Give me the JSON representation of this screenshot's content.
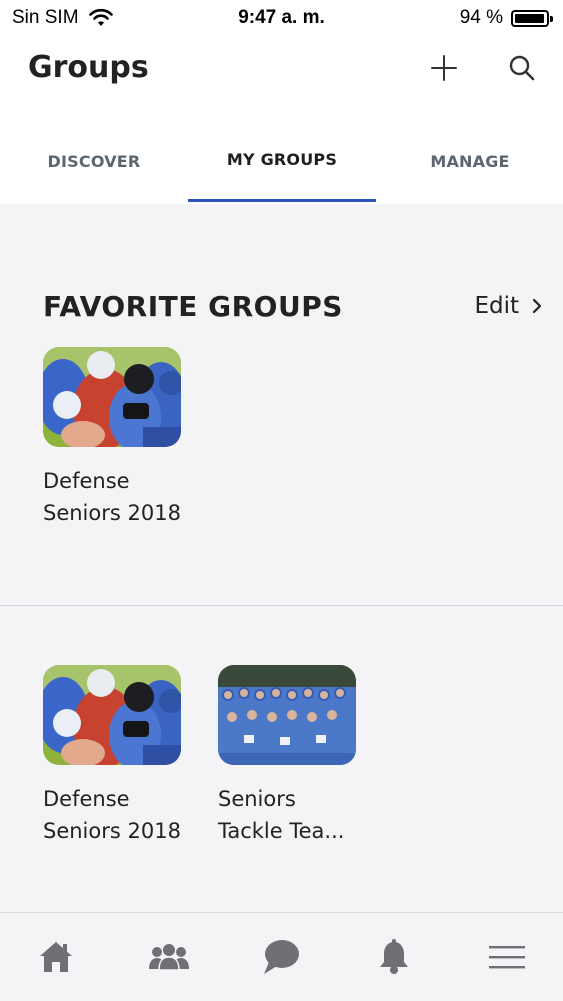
{
  "status_bar": {
    "carrier": "Sin SIM",
    "time": "9:47 a. m.",
    "battery": "94 %",
    "battery_level": 0.94
  },
  "header": {
    "title": "Groups",
    "add_icon": "plus-icon",
    "search_icon": "search-icon"
  },
  "tabs": [
    {
      "label": "DISCOVER",
      "active": false
    },
    {
      "label": "MY GROUPS",
      "active": true
    },
    {
      "label": "MANAGE",
      "active": false
    }
  ],
  "accent_color": "#2a52b8",
  "favorites": {
    "title": "FAVORITE GROUPS",
    "edit_label": "Edit",
    "items": [
      {
        "name_line1": "Defense",
        "name_line2": "Seniors 2018",
        "image": "football-tackle-photo"
      }
    ]
  },
  "groups": {
    "items": [
      {
        "name_line1": "Defense",
        "name_line2": "Seniors 2018",
        "image": "football-tackle-photo"
      },
      {
        "name_line1": "Seniors",
        "name_line2": "Tackle Tea...",
        "image": "team-photo"
      }
    ]
  },
  "tab_bar": [
    {
      "icon": "home-icon"
    },
    {
      "icon": "people-icon"
    },
    {
      "icon": "chat-icon"
    },
    {
      "icon": "bell-icon"
    },
    {
      "icon": "menu-icon"
    }
  ]
}
